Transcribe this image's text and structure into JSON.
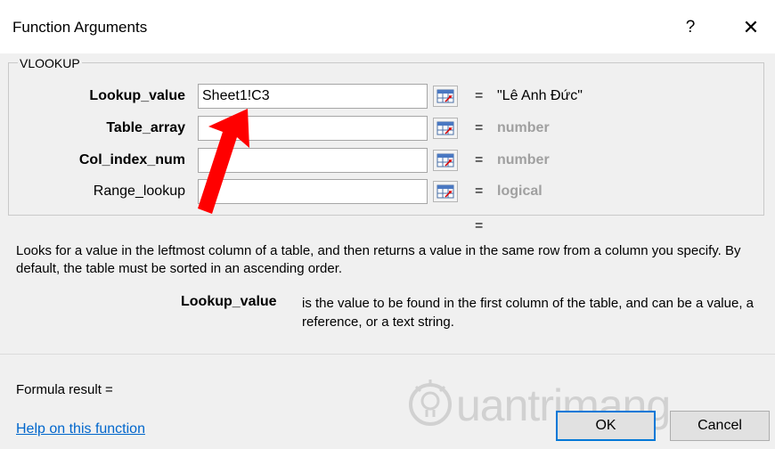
{
  "window": {
    "title": "Function Arguments",
    "help_label": "?",
    "close_label": "✕"
  },
  "function_name": "VLOOKUP",
  "args": [
    {
      "label": "Lookup_value",
      "input": "Sheet1!C3",
      "eq": "=",
      "value": "\"Lê Anh Đức\""
    },
    {
      "label": "Table_array",
      "input": "",
      "eq": "=",
      "value": "number"
    },
    {
      "label": "Col_index_num",
      "input": "",
      "eq": "=",
      "value": "number"
    },
    {
      "label": "Range_lookup",
      "input": "",
      "eq": "=",
      "value": "logical"
    }
  ],
  "result_eq": "=",
  "description": "Looks for a value in the leftmost column of a table, and then returns a value in the same row from a column you specify. By default, the table must be sorted in an ascending order.",
  "arg_help": {
    "name": "Lookup_value",
    "text": "is the value to be found in the first column of the table, and can be a value, a reference, or a text string."
  },
  "formula_result": "Formula result =",
  "help_link": "Help on this function",
  "buttons": {
    "ok": "OK",
    "cancel": "Cancel"
  },
  "watermark": {
    "text": "uantrimang",
    "icon": "lightbulb-icon"
  },
  "annotation": {
    "arrow_color": "#ff0000",
    "icon": "red-arrow"
  }
}
